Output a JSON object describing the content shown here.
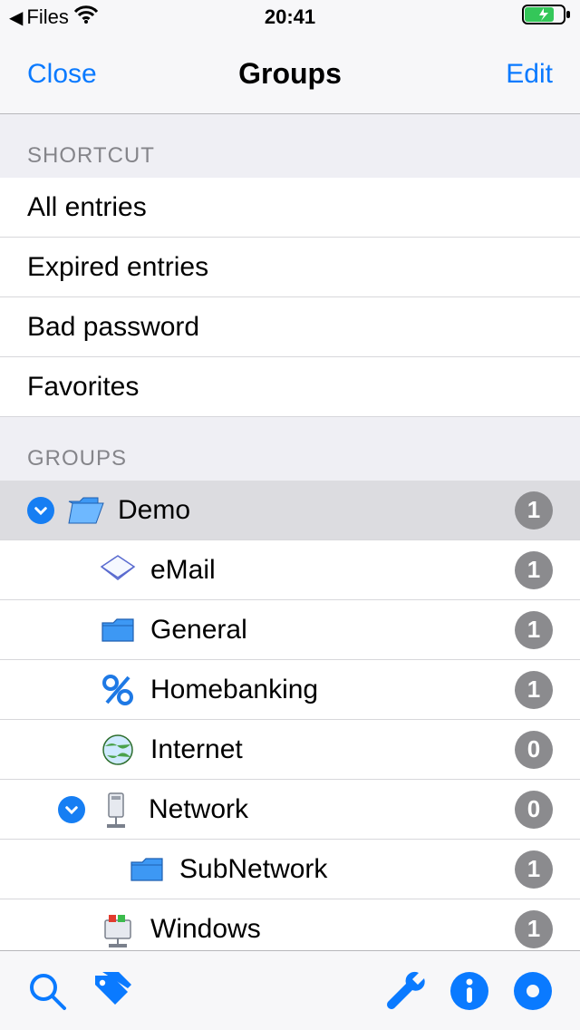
{
  "status_bar": {
    "back_app_label": "Files",
    "time": "20:41"
  },
  "nav": {
    "close": "Close",
    "title": "Groups",
    "edit": "Edit"
  },
  "sections": {
    "shortcut_header": "SHORTCUT",
    "groups_header": "GROUPS"
  },
  "shortcuts": [
    {
      "label": "All entries"
    },
    {
      "label": "Expired entries"
    },
    {
      "label": "Bad password"
    },
    {
      "label": "Favorites"
    }
  ],
  "groups": [
    {
      "label": "Demo",
      "count": "1",
      "level": 0,
      "expanded": true,
      "icon": "folder-open",
      "selected": true
    },
    {
      "label": "eMail",
      "count": "1",
      "level": 1,
      "expanded": null,
      "icon": "mail"
    },
    {
      "label": "General",
      "count": "1",
      "level": 1,
      "expanded": null,
      "icon": "folder"
    },
    {
      "label": "Homebanking",
      "count": "1",
      "level": 1,
      "expanded": null,
      "icon": "percent"
    },
    {
      "label": "Internet",
      "count": "0",
      "level": 1,
      "expanded": null,
      "icon": "globe"
    },
    {
      "label": "Network",
      "count": "0",
      "level": 1,
      "expanded": true,
      "icon": "server"
    },
    {
      "label": "SubNetwork",
      "count": "1",
      "level": 2,
      "expanded": null,
      "icon": "folder"
    },
    {
      "label": "Windows",
      "count": "1",
      "level": 1,
      "expanded": null,
      "icon": "windows"
    }
  ],
  "colors": {
    "tint": "#0a7aff",
    "badge": "#8b8b8e",
    "disclosure_bg": "#167ef3",
    "battery_fill": "#34c759"
  }
}
